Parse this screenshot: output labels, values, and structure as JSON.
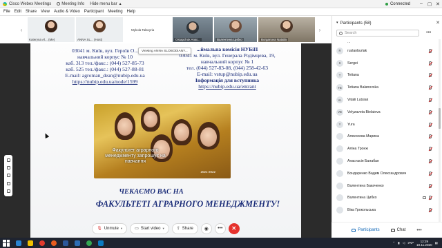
{
  "titlebar": {
    "app_name": "Cisco Webex Meetings",
    "meeting_info": "Meeting Info",
    "hide_menu": "Hide menu bar",
    "status": "Connected",
    "win_min": "–",
    "win_max": "▢",
    "win_close": "✕"
  },
  "menubar": {
    "items": [
      "File",
      "Edit",
      "Share",
      "View",
      "Audio & Video",
      "Participant",
      "Meeting",
      "Help"
    ]
  },
  "strip": {
    "nav_prev": "‹",
    "nav_next": "›",
    "tiles": [
      {
        "label": "Kateryna Al... (Me)"
      },
      {
        "label": "ANNA SL... (Host)"
      },
      {
        "label": "Mykola Talavyria"
      },
      {
        "label": "Ostapchuk Anat..."
      },
      {
        "label": "Валентина Цибко"
      },
      {
        "label": "Borganova Natalia"
      }
    ]
  },
  "viewing": "Viewing ANNA SLOBODIANY...",
  "slide": {
    "left": {
      "header": "",
      "lines": [
        "03041 м. Київ, вул. Героїв О...",
        "навчальний корпус № 10",
        "каб. 313 тел./факс.: (044) 527-85-73",
        "каб. 525 тел./факс.: (044) 527-88-81",
        "E-mail: agroman_dean@nubip.edu.ua"
      ],
      "link": "https://nubip.edu.ua/node/1599"
    },
    "right": {
      "header": "...ймальна комісія НУБіП",
      "lines": [
        "03041 м. Київ, вул. Генерала Родімцева, 19,",
        "навчальний корпус № 1",
        "тел. (044) 527-83-08, (044) 258-42-63",
        "E-mail: vstup@nubip.edu.ua"
      ],
      "info": "Інформація для вступника",
      "link": "https://nubip.edu.ua/entrant"
    },
    "photo_caption": "Факультет аграрного менеджменту запрошує на навчання",
    "photo_years": "2021-2022",
    "slogan1": "ЧЕКАЄМО ВАС НА",
    "slogan2": "ФАКУЛЬТЕТІ АГРАРНОГО МЕНЕДЖМЕНТУ!"
  },
  "controls": {
    "unmute": "Unmute",
    "start_video": "Start video",
    "share": "Share",
    "more": "•••",
    "end": "✕"
  },
  "panel": {
    "title": "Participants (58)",
    "search_placeholder": "Search",
    "more": "•••",
    "participants": [
      {
        "initials": "",
        "name": "..."
      },
      {
        "initials": "R",
        "name": "ruslanburlak"
      },
      {
        "initials": "S",
        "name": "Sergei"
      },
      {
        "initials": "T",
        "name": "Tetiana"
      },
      {
        "initials": "TB",
        "name": "Tetiana Balanovska"
      },
      {
        "initials": "VL",
        "name": "Vitalii Lutsiak"
      },
      {
        "initials": "VB",
        "name": "Velyzaveta Bielaieva"
      },
      {
        "initials": "Y",
        "name": "Yura"
      },
      {
        "initials": "",
        "name": "Алексеева Марина"
      },
      {
        "initials": "",
        "name": "Аліна Тронж"
      },
      {
        "initials": "",
        "name": "Анастасія Балабан"
      },
      {
        "initials": "",
        "name": "Бондаренко Вадим Олександрович"
      },
      {
        "initials": "",
        "name": "Валентина Бакаченко"
      },
      {
        "initials": "",
        "name": "Валентина Цибко"
      },
      {
        "initials": "",
        "name": "Віка Грокольська"
      }
    ]
  },
  "panel_tabs": {
    "participants": "Participants",
    "chat": "Chat",
    "more": "•••"
  },
  "taskbar": {
    "lang": "УКР",
    "time": "12:29",
    "date": "18.11.2020"
  },
  "colors": {
    "accent": "#0a63b4",
    "end_call": "#e5322d",
    "slide_text": "#1e2f7a",
    "connected": "#2e9e44"
  }
}
